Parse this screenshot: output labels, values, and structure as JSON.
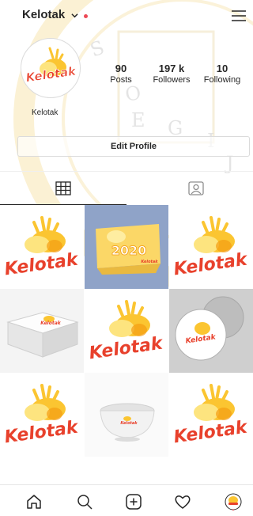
{
  "header": {
    "username": "Kelotak",
    "icons": [
      "chevron-down-icon",
      "menu-icon"
    ]
  },
  "profile": {
    "avatar_logo": "Kelotak",
    "display_name": "Kelotak",
    "stats": [
      {
        "value": "90",
        "label": "Posts"
      },
      {
        "value": "197 k",
        "label": "Followers"
      },
      {
        "value": "10",
        "label": "Following"
      }
    ],
    "edit_button": "Edit Profile"
  },
  "tabs": [
    {
      "icon": "grid-icon",
      "active": true
    },
    {
      "icon": "tagged-icon",
      "active": false
    }
  ],
  "posts": [
    {
      "kind": "logo",
      "text": "Kelotak"
    },
    {
      "kind": "calendar",
      "text": "2020",
      "small": "Kelotak"
    },
    {
      "kind": "logo",
      "text": "Kelotak"
    },
    {
      "kind": "box",
      "text": "Kelotak"
    },
    {
      "kind": "logo",
      "text": "Kelotak"
    },
    {
      "kind": "pin",
      "text": "Kelotak"
    },
    {
      "kind": "logo",
      "text": "Kelotak"
    },
    {
      "kind": "bowl",
      "text": "Kelotak"
    },
    {
      "kind": "logo",
      "text": "Kelotak"
    }
  ],
  "bottom_nav": [
    "home-icon",
    "search-icon",
    "add-post-icon",
    "heart-icon",
    "profile-avatar"
  ],
  "colors": {
    "logo_red": "#e8412c",
    "logo_yellow": "#fbc531",
    "logo_orange": "#f39c12",
    "calendar_bg": "#8fa3c8",
    "notif": "#ed4956"
  }
}
